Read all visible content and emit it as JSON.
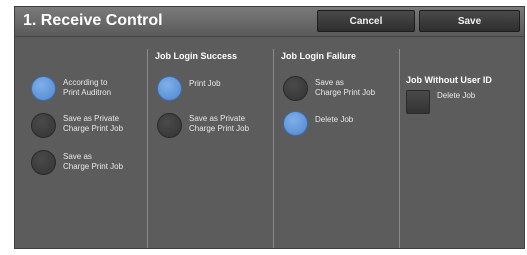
{
  "header": {
    "title": "1. Receive Control",
    "cancel_label": "Cancel",
    "save_label": "Save"
  },
  "col1": {
    "options": [
      {
        "line1": "According to",
        "line2": "Print Auditron",
        "selected": true
      },
      {
        "line1": "Save as Private",
        "line2": "Charge Print Job",
        "selected": false
      },
      {
        "line1": "Save as",
        "line2": "Charge Print Job",
        "selected": false
      }
    ]
  },
  "col2": {
    "heading": "Job Login Success",
    "options": [
      {
        "line1": "Print Job",
        "line2": "",
        "selected": true
      },
      {
        "line1": "Save as Private",
        "line2": "Charge Print Job",
        "selected": false
      }
    ]
  },
  "col3": {
    "heading": "Job Login Failure",
    "options": [
      {
        "line1": "Save as",
        "line2": "Charge Print Job",
        "selected": false
      },
      {
        "line1": "Delete Job",
        "line2": "",
        "selected": true
      }
    ]
  },
  "col4": {
    "heading": "Job Without User ID",
    "checkbox_label": "Delete Job",
    "checked": false
  },
  "colors": {
    "selected_radio": "#5a8fd6",
    "panel_bg": "#5c5c5c",
    "text": "#ffffff"
  }
}
